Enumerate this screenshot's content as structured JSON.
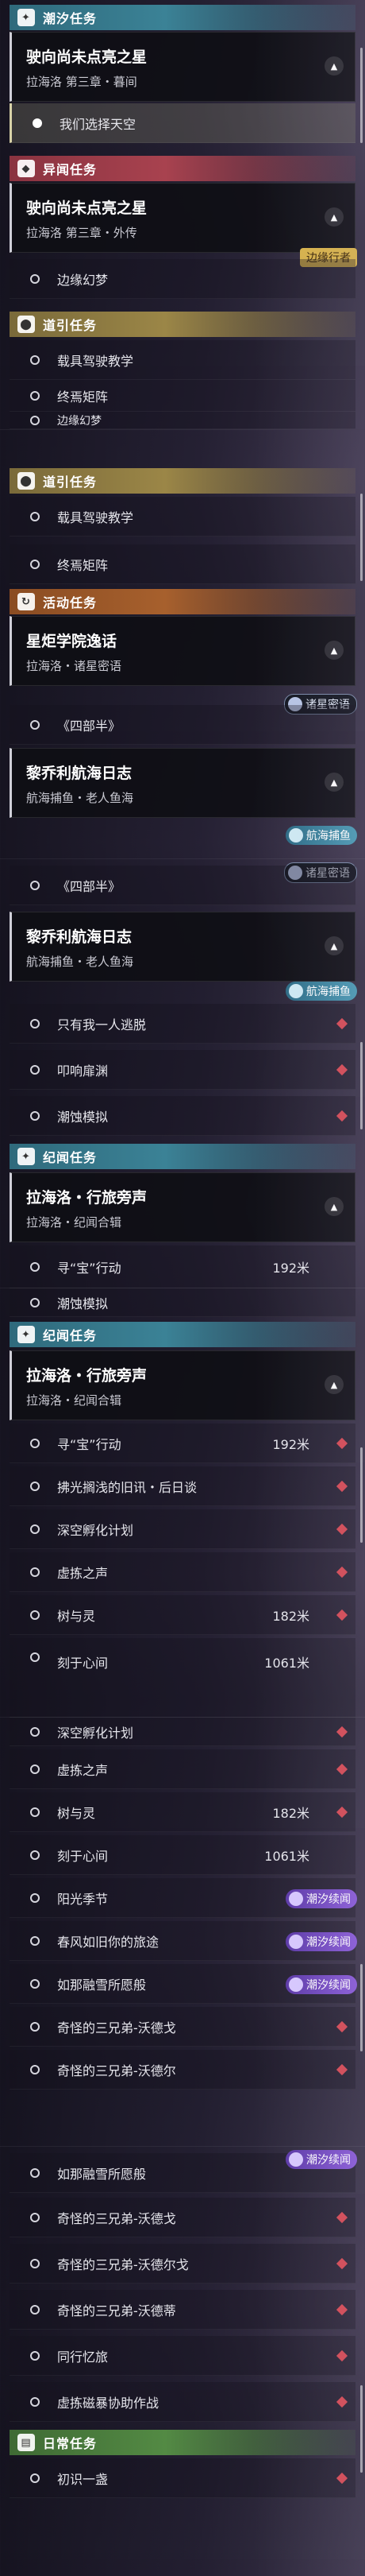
{
  "panels": [
    {
      "cat1": "潮汐任务",
      "card1": {
        "title": "驶向尚未点亮之星",
        "sub": "拉海洛 第三章・暮间"
      },
      "item_sel": "我们选择天空",
      "cat2": "异闻任务",
      "card2": {
        "title": "驶向尚未点亮之星",
        "sub": "拉海洛 第三章・外传",
        "tag": "边缘行者"
      },
      "item2": "边缘幻梦",
      "cat3": "道引任务",
      "item3": "载具驾驶教学",
      "item4": "终焉矩阵",
      "item5": "边缘幻梦"
    },
    {
      "cat1": "道引任务",
      "item1": "载具驾驶教学",
      "item2": "终焉矩阵",
      "cat2": "活动任务",
      "card1": {
        "title": "星炬学院逸话",
        "sub": "拉海洛・诸星密语",
        "tag": "诸星密语"
      },
      "item3": "《四部半》",
      "card2": {
        "title": "黎乔利航海日志",
        "sub": "航海捕鱼・老人鱼海",
        "tag": "航海捕鱼"
      }
    },
    {
      "tag_top": "诸星密语",
      "item1": "《四部半》",
      "card1": {
        "title": "黎乔利航海日志",
        "sub": "航海捕鱼・老人鱼海",
        "tag": "航海捕鱼"
      },
      "items": [
        "只有我一人逃脱",
        "叩响扉渊",
        "潮蚀模拟"
      ],
      "cat1": "纪闻任务",
      "card2": {
        "title": "拉海洛・行旅旁声",
        "sub": "拉海洛・纪闻合辑"
      },
      "item_cut": "寻“宝”行动",
      "item_cut_dist": "192米"
    },
    {
      "item_top": "潮蚀模拟",
      "cat1": "纪闻任务",
      "card1": {
        "title": "拉海洛・行旅旁声",
        "sub": "拉海洛・纪闻合辑"
      },
      "items": [
        {
          "label": "寻“宝”行动",
          "dist": "192米"
        },
        {
          "label": "拂光搁浅的旧讯・后日谈",
          "dist": ""
        },
        {
          "label": "深空孵化计划",
          "dist": ""
        },
        {
          "label": "虚拣之声",
          "dist": ""
        },
        {
          "label": "树与灵",
          "dist": "182米"
        },
        {
          "label": "刻于心间",
          "dist": "1061米"
        }
      ]
    },
    {
      "items": [
        {
          "label": "深空孵化计划",
          "dist": "",
          "tag": ""
        },
        {
          "label": "虚拣之声",
          "dist": "",
          "tag": ""
        },
        {
          "label": "树与灵",
          "dist": "182米",
          "tag": ""
        },
        {
          "label": "刻于心间",
          "dist": "1061米",
          "tag": ""
        },
        {
          "label": "阳光季节",
          "dist": "",
          "tag": "潮汐续闻"
        },
        {
          "label": "春风如旧你的旅途",
          "dist": "",
          "tag": "潮汐续闻"
        },
        {
          "label": "如那融雪所愿般",
          "dist": "",
          "tag": "潮汐续闻"
        },
        {
          "label": "奇怪的三兄弟-沃德戈",
          "dist": "",
          "tag": ""
        },
        {
          "label": "奇怪的三兄弟-沃德尔",
          "dist": "",
          "tag": ""
        }
      ]
    },
    {
      "items": [
        {
          "label": "如那融雪所愿般",
          "tag": "潮汐续闻"
        },
        {
          "label": "奇怪的三兄弟-沃德戈",
          "tag": ""
        },
        {
          "label": "奇怪的三兄弟-沃德尔戈",
          "tag": ""
        },
        {
          "label": "奇怪的三兄弟-沃德蒂",
          "tag": ""
        },
        {
          "label": "同行忆旅",
          "tag": ""
        },
        {
          "label": "虚拣磁暴协助作战",
          "tag": ""
        }
      ],
      "cat1": "日常任务",
      "item_last": "初识一盏"
    }
  ]
}
